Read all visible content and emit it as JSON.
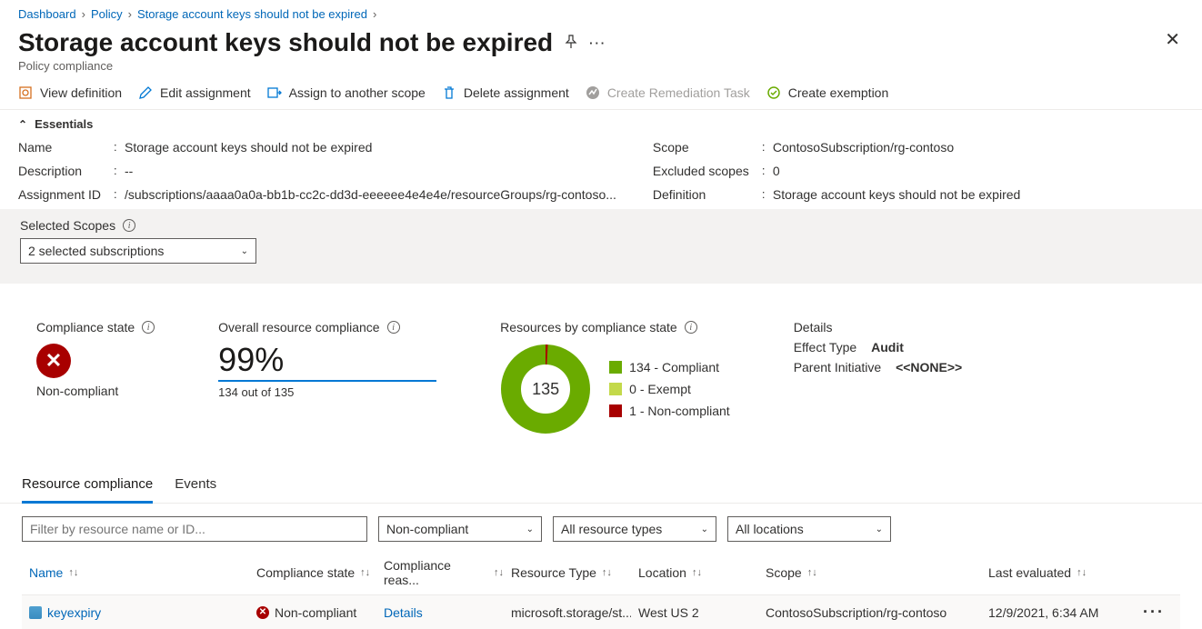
{
  "breadcrumb": {
    "items": [
      "Dashboard",
      "Policy",
      "Storage account keys should not be expired"
    ]
  },
  "header": {
    "title": "Storage account keys should not be expired",
    "subtitle": "Policy compliance"
  },
  "toolbar": {
    "view_definition": "View definition",
    "edit_assignment": "Edit assignment",
    "assign_scope": "Assign to another scope",
    "delete_assignment": "Delete assignment",
    "create_remediation": "Create Remediation Task",
    "create_exemption": "Create exemption"
  },
  "essentials": {
    "heading": "Essentials",
    "name_label": "Name",
    "name_value": "Storage account keys should not be expired",
    "description_label": "Description",
    "description_value": "--",
    "assignment_id_label": "Assignment ID",
    "assignment_id_value": "/subscriptions/aaaa0a0a-bb1b-cc2c-dd3d-eeeeee4e4e4e/resourceGroups/rg-contoso...",
    "scope_label": "Scope",
    "scope_value": "ContosoSubscription/rg-contoso",
    "excluded_label": "Excluded scopes",
    "excluded_value": "0",
    "definition_label": "Definition",
    "definition_value": "Storage account keys should not be expired"
  },
  "scopes": {
    "label": "Selected Scopes",
    "selected": "2 selected subscriptions"
  },
  "compliance": {
    "state_title": "Compliance state",
    "state_value": "Non-compliant",
    "overall_title": "Overall resource compliance",
    "overall_pct": "99%",
    "overall_sub": "134 out of 135",
    "bystate_title": "Resources by compliance state",
    "donut_center": "135",
    "legend": {
      "compliant": {
        "count": "134",
        "label": "Compliant",
        "color": "#6aab00"
      },
      "exempt": {
        "count": "0",
        "label": "Exempt",
        "color": "#c3d94a"
      },
      "noncompliant": {
        "count": "1",
        "label": "Non-compliant",
        "color": "#a80000"
      }
    },
    "details_title": "Details",
    "effect_label": "Effect Type",
    "effect_value": "Audit",
    "parent_label": "Parent Initiative",
    "parent_value": "<<NONE>>"
  },
  "tabs": {
    "resource_compliance": "Resource compliance",
    "events": "Events"
  },
  "filters": {
    "search_placeholder": "Filter by resource name or ID...",
    "compliance_dd": "Non-compliant",
    "resource_types_dd": "All resource types",
    "locations_dd": "All locations"
  },
  "table": {
    "cols": {
      "name": "Name",
      "compliance": "Compliance state",
      "reason": "Compliance reas...",
      "type": "Resource Type",
      "location": "Location",
      "scope": "Scope",
      "last": "Last evaluated"
    },
    "row": {
      "name": "keyexpiry",
      "compliance": "Non-compliant",
      "reason": "Details",
      "type": "microsoft.storage/st...",
      "location": "West US 2",
      "scope": "ContosoSubscription/rg-contoso",
      "last": "12/9/2021, 6:34 AM"
    }
  }
}
